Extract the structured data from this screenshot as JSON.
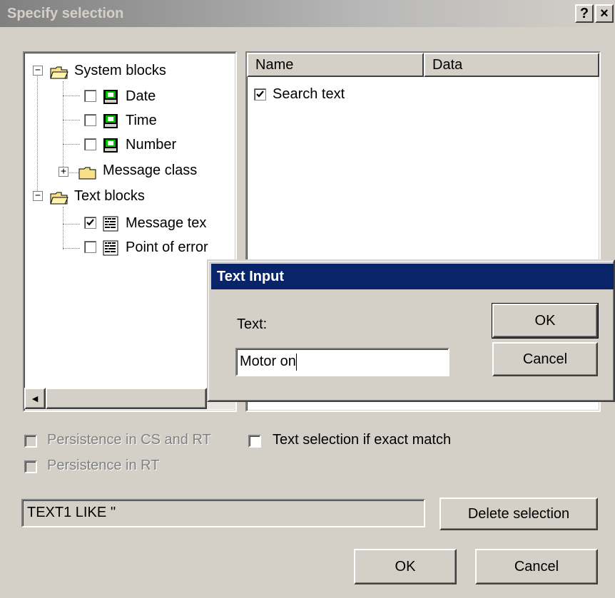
{
  "dialog": {
    "title": "Specify selection",
    "help_button": "?",
    "close_button": "×"
  },
  "tree": {
    "items": [
      {
        "label": "System blocks",
        "type": "folder",
        "expander": "−"
      },
      {
        "label": "Date",
        "checked": false
      },
      {
        "label": "Time",
        "checked": false
      },
      {
        "label": "Number",
        "checked": false
      },
      {
        "label": "Message class",
        "type": "folder",
        "expander": "+"
      },
      {
        "label": "Text blocks",
        "type": "folder",
        "expander": "−"
      },
      {
        "label": "Message tex",
        "checked": true
      },
      {
        "label": "Point of error",
        "checked": false
      }
    ],
    "scroll_left_arrow": "◄"
  },
  "list": {
    "columns": [
      "Name",
      "Data"
    ],
    "rows": [
      {
        "name": "Search text",
        "checked": true,
        "check_glyph": "✔"
      }
    ]
  },
  "options": {
    "persistence_cs_rt": "Persistence in CS and RT",
    "persistence_rt": "Persistence in RT",
    "text_selection_exact": "Text selection if exact match"
  },
  "expression": {
    "value": "TEXT1 LIKE ''"
  },
  "buttons": {
    "delete_selection": "Delete selection",
    "ok": "OK",
    "cancel": "Cancel"
  },
  "text_input_dialog": {
    "title": "Text Input",
    "label": "Text:",
    "value": "Motor on",
    "ok": "OK",
    "cancel": "Cancel"
  },
  "colors": {
    "active_title": "#0a246a",
    "face": "#d4d0c8"
  }
}
